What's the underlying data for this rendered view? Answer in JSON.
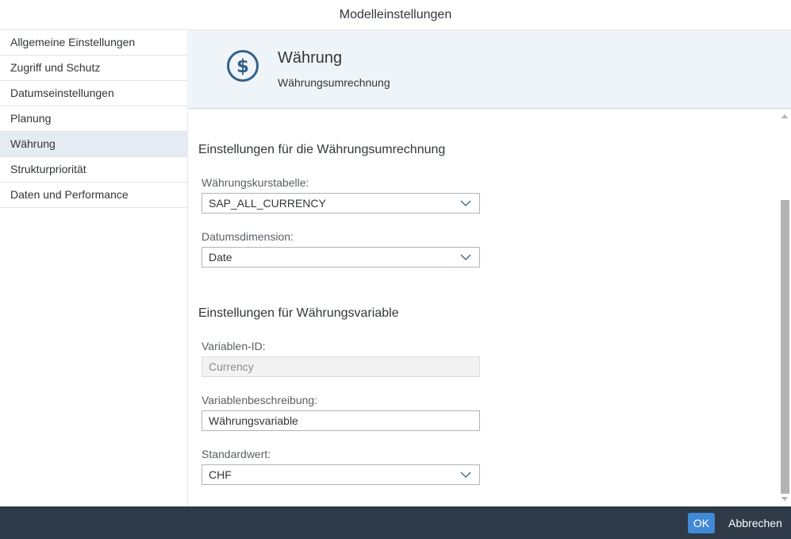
{
  "dialog": {
    "title": "Modelleinstellungen"
  },
  "nav": {
    "items": [
      {
        "label": "Allgemeine Einstellungen"
      },
      {
        "label": "Zugriff und Schutz"
      },
      {
        "label": "Datumseinstellungen"
      },
      {
        "label": "Planung"
      },
      {
        "label": "Währung"
      },
      {
        "label": "Strukturpriorität"
      },
      {
        "label": "Daten und Performance"
      }
    ],
    "selected": "Währung"
  },
  "header": {
    "icon": "dollar-circle-icon",
    "title": "Währung",
    "subtitle": "Währungsumrechnung",
    "accent_color": "#346187"
  },
  "conversion": {
    "section_title": "Einstellungen für die Währungsumrechnung",
    "rate_table": {
      "label": "Währungskurstabelle:",
      "value": "SAP_ALL_CURRENCY"
    },
    "date_dimension": {
      "label": "Datumsdimension:",
      "value": "Date"
    }
  },
  "variable": {
    "section_title": "Einstellungen für Währungsvariable",
    "variable_id": {
      "label": "Variablen-ID:",
      "placeholder": "Currency"
    },
    "description": {
      "label": "Variablenbeschreibung:",
      "value": "Währungsvariable"
    },
    "default_value": {
      "label": "Standardwert:",
      "value": "CHF"
    }
  },
  "footer": {
    "ok_label": "OK",
    "cancel_label": "Abbrechen",
    "ok_color": "#4189d6",
    "bar_color": "#2e3a47"
  }
}
